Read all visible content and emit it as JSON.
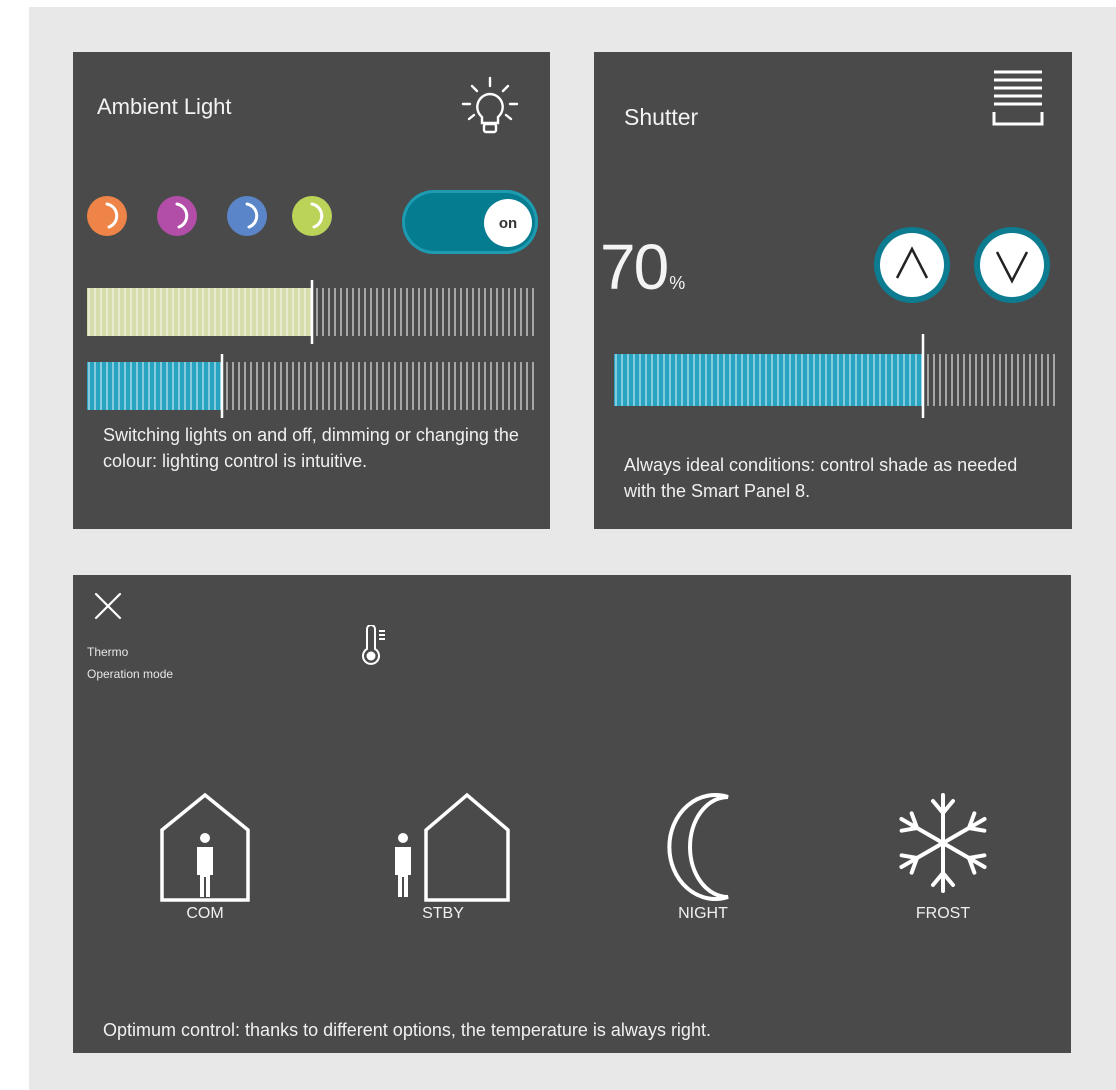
{
  "ambient_light": {
    "title": "Ambient Light",
    "icon": "lightbulb-icon",
    "color_presets": [
      {
        "name": "orange",
        "color": "#ee8447"
      },
      {
        "name": "magenta",
        "color": "#b24ea8"
      },
      {
        "name": "blue",
        "color": "#5a86c9"
      },
      {
        "name": "lime",
        "color": "#bcd35a"
      }
    ],
    "toggle_label": "on",
    "toggle_color": "#067c91",
    "brightness_level": 0.5,
    "brightness_color": "#d6dcaa",
    "color_temp_level": 0.3,
    "color_temp_color": "#28a3c1",
    "caption": "Switching lights on and off, dimming or changing the colour: lighting control is intuitive."
  },
  "shutter": {
    "title": "Shutter",
    "icon": "window-blind-icon",
    "position_value": "70",
    "position_unit": "%",
    "level": 0.7,
    "bar_color": "#28a3c1",
    "up_icon": "chevron-up-icon",
    "down_icon": "chevron-down-icon",
    "caption": "Always ideal conditions: control shade as needed with the Smart Panel 8."
  },
  "thermo": {
    "close_icon": "close-icon",
    "title": "Thermo",
    "subtitle": "Operation mode",
    "icon": "thermometer-icon",
    "modes": [
      {
        "label": "COM",
        "icon": "house-person-icon"
      },
      {
        "label": "STBY",
        "icon": "person-outside-house-icon"
      },
      {
        "label": "NIGHT",
        "icon": "moon-icon"
      },
      {
        "label": "FROST",
        "icon": "snowflake-icon"
      }
    ],
    "caption": "Optimum control: thanks to different options, the temperature is always right."
  }
}
